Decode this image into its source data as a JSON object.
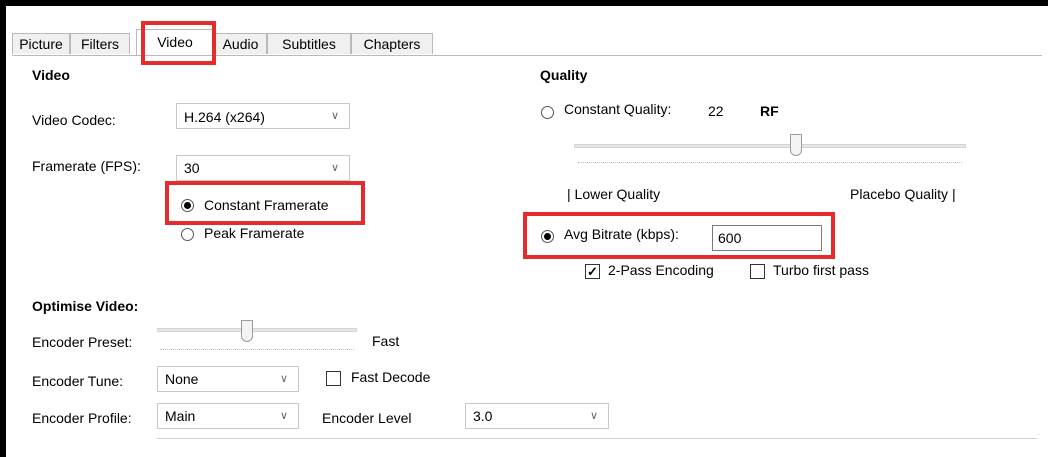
{
  "tabs": [
    "Picture",
    "Filters",
    "Video",
    "Audio",
    "Subtitles",
    "Chapters"
  ],
  "video": {
    "section_title": "Video",
    "codec_label": "Video Codec:",
    "codec_value": "H.264 (x264)",
    "framerate_label": "Framerate (FPS):",
    "framerate_value": "30",
    "constant_framerate": "Constant Framerate",
    "peak_framerate": "Peak Framerate",
    "constant_selected": true
  },
  "quality": {
    "section_title": "Quality",
    "constant_quality_label": "Constant Quality:",
    "rf_value": "22",
    "rf_unit": "RF",
    "rf_slider_level": 0.6,
    "lower_quality": "| Lower Quality",
    "placebo_quality": "Placebo Quality |",
    "avg_bitrate_label": "Avg Bitrate (kbps):",
    "avg_bitrate_value": "600",
    "avg_bitrate_selected": true,
    "two_pass_label": "2-Pass Encoding",
    "two_pass_checked": true,
    "turbo_label": "Turbo first pass",
    "turbo_checked": false
  },
  "optimise": {
    "section_title": "Optimise Video:",
    "preset_label": "Encoder Preset:",
    "preset_value": "Fast",
    "preset_slider_level": 0.4,
    "tune_label": "Encoder Tune:",
    "tune_value": "None",
    "fast_decode_label": "Fast Decode",
    "fast_decode_checked": false,
    "profile_label": "Encoder Profile:",
    "profile_value": "Main",
    "level_label": "Encoder Level",
    "level_value": "3.0"
  },
  "highlight_color": "#e52b2b"
}
